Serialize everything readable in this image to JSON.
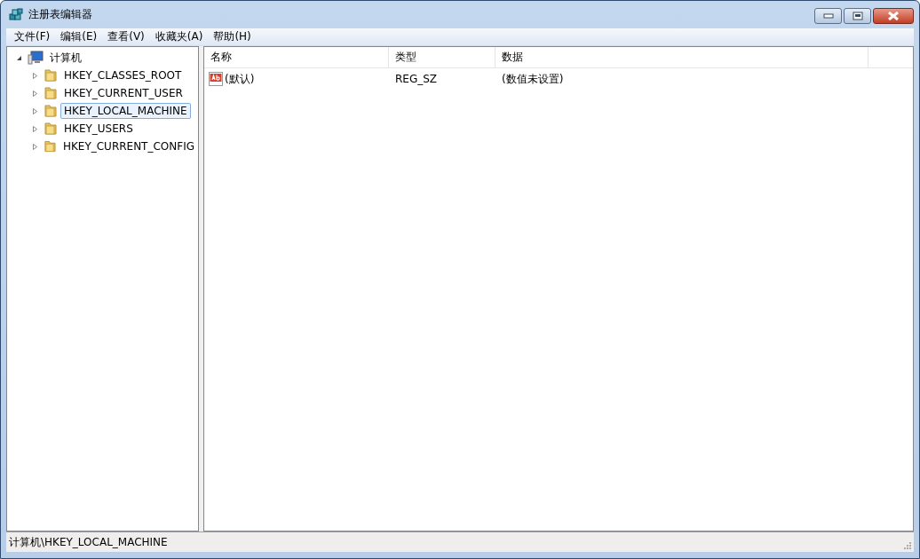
{
  "window": {
    "title": "注册表编辑器"
  },
  "menu": [
    "文件(F)",
    "编辑(E)",
    "查看(V)",
    "收藏夹(A)",
    "帮助(H)"
  ],
  "tree": {
    "label": "计算机",
    "expanded": true,
    "selected": false,
    "children": [
      {
        "label": "HKEY_CLASSES_ROOT",
        "expanded": false,
        "selected": false
      },
      {
        "label": "HKEY_CURRENT_USER",
        "expanded": false,
        "selected": false
      },
      {
        "label": "HKEY_LOCAL_MACHINE",
        "expanded": false,
        "selected": true
      },
      {
        "label": "HKEY_USERS",
        "expanded": false,
        "selected": false
      },
      {
        "label": "HKEY_CURRENT_CONFIG",
        "expanded": false,
        "selected": false
      }
    ]
  },
  "table": {
    "columns": [
      "名称",
      "类型",
      "数据"
    ],
    "rows": [
      {
        "name": "(默认)",
        "type": "REG_SZ",
        "data": "(数值未设置)"
      }
    ]
  },
  "status_bar": "计算机\\HKEY_LOCAL_MACHINE"
}
